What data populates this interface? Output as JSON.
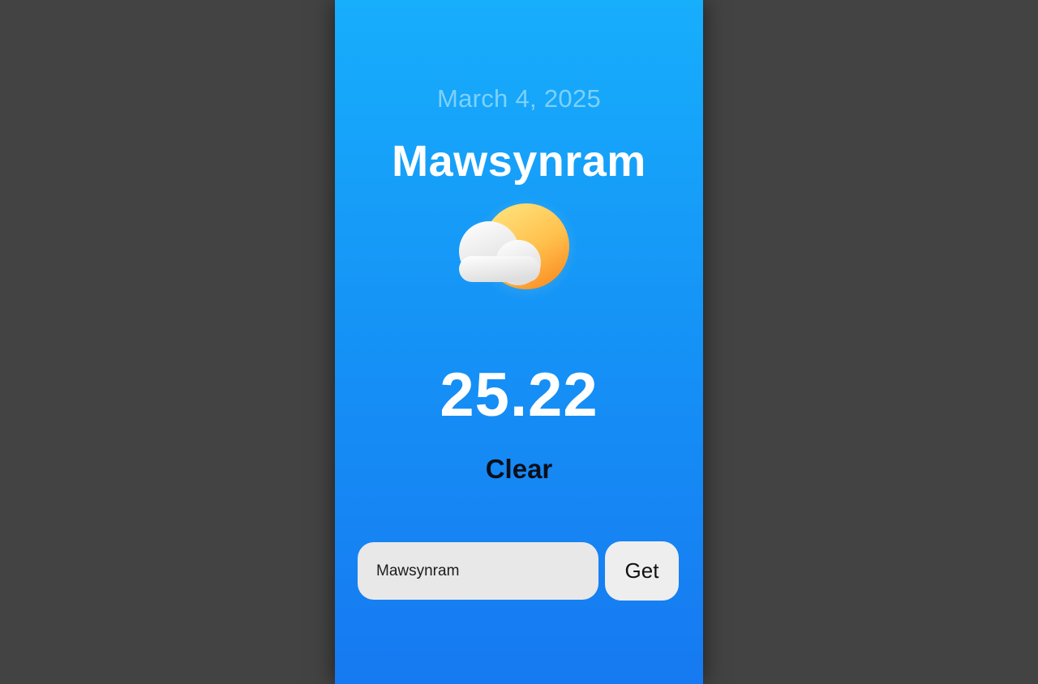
{
  "weather": {
    "date": "March 4, 2025",
    "city": "Mawsynram",
    "temperature": "25.22",
    "condition": "Clear",
    "icon": "sun-behind-cloud-icon"
  },
  "search": {
    "value": "Mawsynram",
    "button_label": "Get"
  },
  "colors": {
    "page_background": "#434343",
    "card_gradient_top": "#17aefc",
    "card_gradient_bottom": "#1679f1",
    "input_background": "#e8e8e8",
    "sun_yellow": "#ffd96a",
    "sun_orange": "#fb9a2b"
  }
}
